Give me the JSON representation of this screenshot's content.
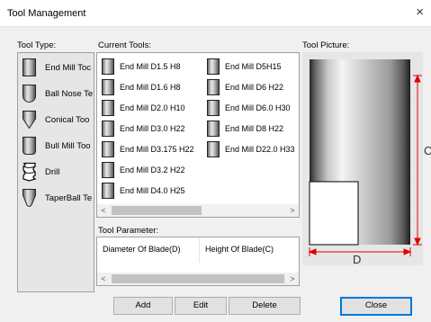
{
  "window": {
    "title": "Tool Management",
    "close_glyph": "×"
  },
  "labels": {
    "tool_type": "Tool Type:",
    "current_tools": "Current Tools:",
    "tool_picture": "Tool Picture:",
    "tool_parameter": "Tool Parameter:"
  },
  "tool_types": [
    {
      "label": "End Mill Toc",
      "icon": "end-mill-icon"
    },
    {
      "label": "Ball Nose Te",
      "icon": "ball-nose-icon"
    },
    {
      "label": "Conical Too",
      "icon": "conical-icon"
    },
    {
      "label": "Bull Mill Too",
      "icon": "bull-mill-icon"
    },
    {
      "label": "Drill",
      "icon": "drill-icon"
    },
    {
      "label": "TaperBall Te",
      "icon": "taper-ball-icon"
    }
  ],
  "current_tools": {
    "col1": [
      "End Mill D1.5 H8",
      "End Mill D1.6 H8",
      "End Mill D2.0 H10",
      "End Mill D3.0 H22",
      "End Mill D3.175 H22",
      "End Mill D3.2 H22",
      "End Mill D4.0 H25"
    ],
    "col2": [
      "End Mill D5H15",
      "End Mill D6 H22",
      "End Mill D6.0 H30",
      "End Mill D8 H22",
      "End Mill D22.0 H33"
    ]
  },
  "tool_parameter": {
    "columns": [
      "Diameter Of Blade(D)",
      "Height Of Blade(C)"
    ]
  },
  "picture": {
    "dim_d": "D",
    "dim_c": "C",
    "dim_color": "#e00000"
  },
  "buttons": {
    "add": "Add",
    "edit": "Edit",
    "delete": "Delete",
    "close": "Close"
  },
  "scroll_arrows": {
    "left": "<",
    "right": ">"
  }
}
